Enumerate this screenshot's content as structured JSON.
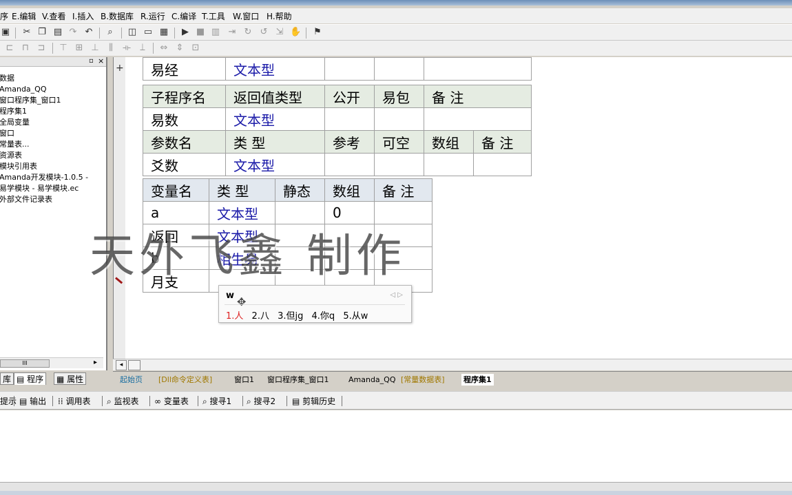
{
  "menu": [
    "序",
    "E.编辑",
    "V.查看",
    "I.插入",
    "B.数据库",
    "R.运行",
    "C.编译",
    "T.工具",
    "W.窗口",
    "H.帮助"
  ],
  "tree": [
    "数据",
    "Amanda_QQ",
    "窗口程序集_窗口1",
    "程序集1",
    "全局变量",
    "窗口",
    "常量表...",
    "资源表",
    "模块引用表",
    "Amanda开发模块-1.0.5 -",
    "易学模块 - 易学模块.ec",
    "外部文件记录表"
  ],
  "editor": {
    "plus": "+",
    "top_row": [
      "易经",
      "文本型",
      "",
      "",
      ""
    ],
    "sub_header": [
      "子程序名",
      "返回值类型",
      "公开",
      "易包",
      "备 注"
    ],
    "sub_row": [
      "易数",
      "文本型",
      "",
      "",
      ""
    ],
    "param_header": [
      "参数名",
      "类 型",
      "参考",
      "可空",
      "数组",
      "备 注"
    ],
    "param_row": [
      "爻数",
      "文本型",
      "",
      "",
      "",
      ""
    ],
    "var_header": [
      "变量名",
      "类 型",
      "静态",
      "数组",
      "备 注"
    ],
    "var_rows": [
      [
        "a",
        "文本型",
        "",
        "0",
        ""
      ],
      [
        "返回",
        "文本型",
        "",
        "",
        ""
      ],
      [
        "b",
        "相生易",
        "",
        "",
        ""
      ],
      [
        "月支",
        "",
        "",
        "",
        ""
      ]
    ]
  },
  "watermark": "天外飞鑫 制作",
  "ime": {
    "input": "w",
    "arrows": "◁ ▷",
    "candidates": [
      "1.人",
      "2.八",
      "3.但jg",
      "4.你q",
      "5.从w"
    ]
  },
  "hscroll": {
    "left": "◂",
    "right": "▸",
    "thumb_mark": "III"
  },
  "left_tabs": [
    "库",
    "程序",
    "属性"
  ],
  "doc_tabs": [
    "起始页",
    "[Dll命令定义表]",
    "窗口1",
    "窗口程序集_窗口1",
    "Amanda_QQ",
    "[常量数据表]",
    "程序集1"
  ],
  "output_tabs": [
    "提示",
    "输出",
    "调用表",
    "监视表",
    "变量表",
    "搜寻1",
    "搜寻2",
    "剪辑历史"
  ]
}
